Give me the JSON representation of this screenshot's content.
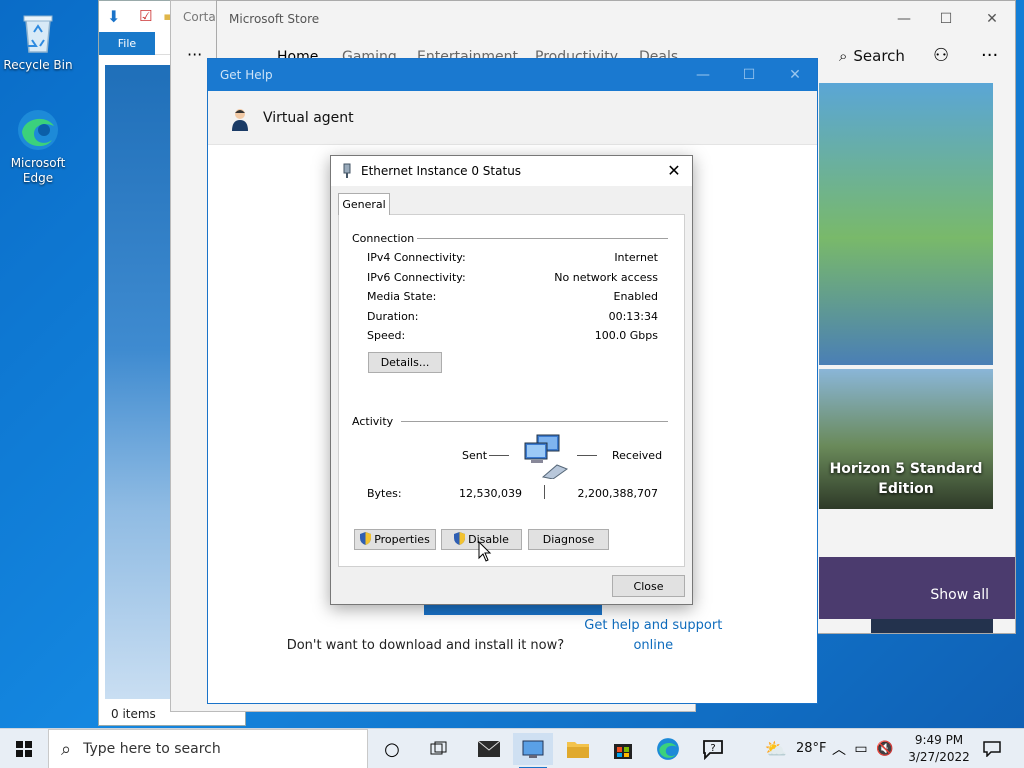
{
  "desktop": {
    "icons": [
      {
        "label": "Recycle Bin"
      },
      {
        "label": "Microsoft Edge"
      }
    ]
  },
  "explorer": {
    "file_tab": "File",
    "status": "0 items"
  },
  "cortana": {
    "title": "Cortar"
  },
  "store": {
    "title": "Microsoft Store",
    "nav": [
      "Home",
      "Gaming",
      "Entertainment",
      "Productivity",
      "Deals"
    ],
    "search_label": "Search",
    "more": "···",
    "tile_caption": "Horizon 5 Standard Edition",
    "show_all": "Show all"
  },
  "gethelp": {
    "title": "Get Help",
    "agent_name": "Virtual agent",
    "help_text": "Don't want to download and install it now?",
    "help_link": "Get help and support online"
  },
  "ethernet": {
    "title": "Ethernet Instance 0 Status",
    "tab": "General",
    "connection_group": "Connection",
    "rows": [
      {
        "label": "IPv4 Connectivity:",
        "value": "Internet"
      },
      {
        "label": "IPv6 Connectivity:",
        "value": "No network access"
      },
      {
        "label": "Media State:",
        "value": "Enabled"
      },
      {
        "label": "Duration:",
        "value": "00:13:34"
      },
      {
        "label": "Speed:",
        "value": "100.0 Gbps"
      }
    ],
    "details_button": "Details...",
    "activity_group": "Activity",
    "sent_label": "Sent",
    "received_label": "Received",
    "bytes_label": "Bytes:",
    "bytes_sent": "12,530,039",
    "bytes_received": "2,200,388,707",
    "properties_button": "Properties",
    "disable_button": "Disable",
    "diagnose_button": "Diagnose",
    "close_button": "Close"
  },
  "taskbar": {
    "search_placeholder": "Type here to search",
    "weather_temp": "28°F",
    "time": "9:49 PM",
    "date": "3/27/2022"
  }
}
